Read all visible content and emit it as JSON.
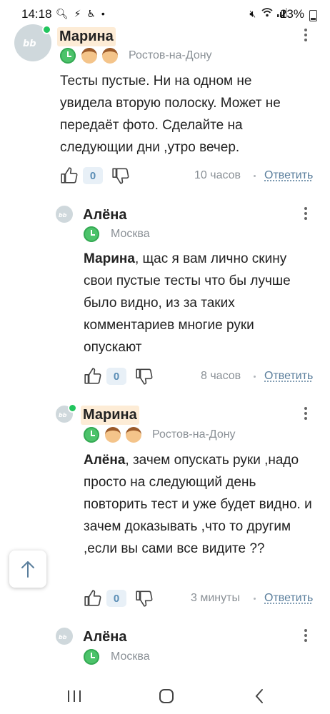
{
  "status_bar": {
    "time": "14:18",
    "left_icons": [
      "search-icon",
      "lightning-icon",
      "accessibility-icon",
      "dot-icon"
    ],
    "right_icons": [
      "mute-icon",
      "wifi-icon",
      "signal-icon"
    ],
    "battery": "23%"
  },
  "comments": [
    {
      "author": "Марина",
      "avatar_text": "",
      "online": true,
      "location": "Ростов-на-Дону",
      "text": "Тесты пустые. Ни на одном не увидела вторую полоску. Может не передаёт фото. Сделайте на следующии дни ,утро вечер.",
      "likes": "0",
      "time": "10 часов",
      "reply_label": "Ответить"
    },
    {
      "author": "Алёна",
      "avatar_text": "",
      "online": false,
      "location": "Москва",
      "mention": "Марина",
      "text": ", щас я вам лично скину свои пустые тесты что бы лучше было видно, из за таких комментариев многие руки опускают",
      "likes": "0",
      "time": "8 часов",
      "reply_label": "Ответить"
    },
    {
      "author": "Марина",
      "avatar_text": "",
      "online": true,
      "location": "Ростов-на-Дону",
      "mention": "Алёна",
      "text": ", зачем опускать руки ,надо просто на следующий день повторить тест и уже будет видно. и зачем доказывать ,что то другим ,если вы сами все видите ??",
      "likes": "0",
      "time": "3 минуты",
      "reply_label": "Ответить"
    },
    {
      "author": "Алёна",
      "avatar_text": "",
      "online": false,
      "location": "Москва"
    }
  ],
  "colors": {
    "accent_link": "#5a7e9c",
    "online": "#22c55e",
    "name_highlight": "#fdecd6",
    "like_badge_bg": "#e8f0f7"
  }
}
